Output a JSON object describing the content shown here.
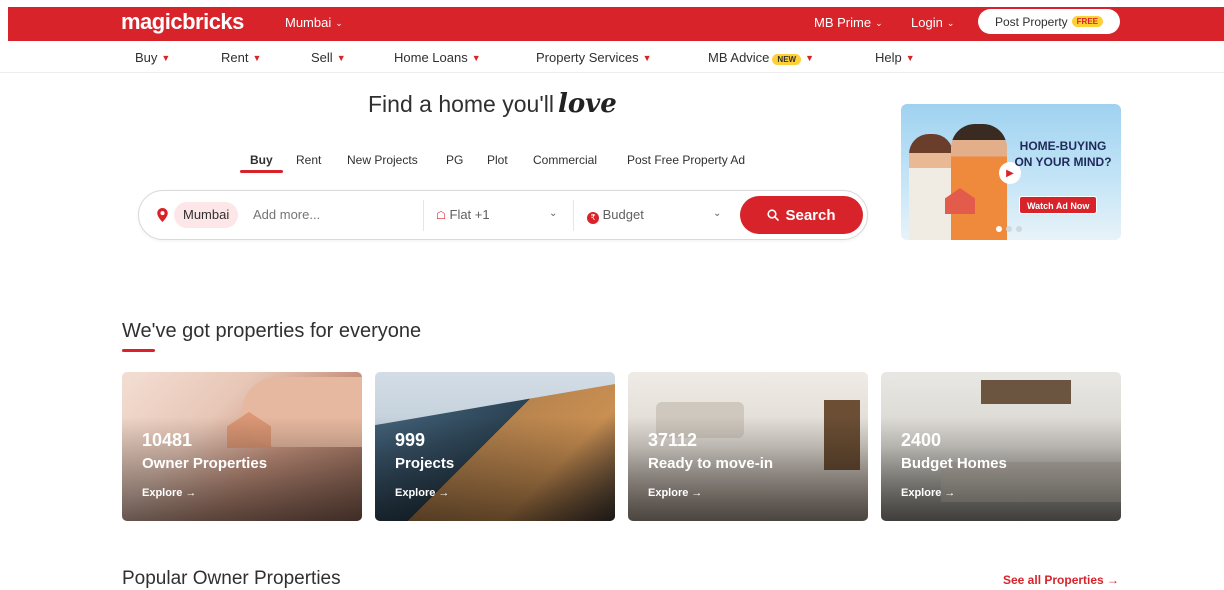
{
  "header": {
    "logo": "magicbricks",
    "city": "Mumbai",
    "mb_prime": "MB Prime",
    "login": "Login",
    "post_property": "Post Property",
    "post_property_badge": "FREE"
  },
  "subnav": {
    "items": [
      {
        "label": "Buy"
      },
      {
        "label": "Rent"
      },
      {
        "label": "Sell"
      },
      {
        "label": "Home Loans"
      },
      {
        "label": "Property Services"
      },
      {
        "label": "MB Advice",
        "badge": "NEW"
      },
      {
        "label": "Help"
      }
    ]
  },
  "hero": {
    "title": "Find a home you'll",
    "title_script": "love"
  },
  "search_tabs": {
    "active": "Buy",
    "items": [
      "Buy",
      "Rent",
      "New Projects",
      "PG",
      "Plot",
      "Commercial",
      "Post Free Property Ad"
    ]
  },
  "search": {
    "city_chip": "Mumbai",
    "placeholder": "Add more...",
    "property_type": "Flat +1",
    "budget": "Budget",
    "button_label": "Search"
  },
  "ad": {
    "headline": "HOME-BUYING ON YOUR MIND?",
    "cta": "Watch Ad Now",
    "slides": 3,
    "active_slide": 1
  },
  "section_everyone": {
    "title": "We've got properties for everyone",
    "cards": [
      {
        "count": "10481",
        "label": "Owner Properties",
        "explore": "Explore →"
      },
      {
        "count": "999",
        "label": "Projects",
        "explore": "Explore →"
      },
      {
        "count": "37112",
        "label": "Ready to move-in",
        "explore": "Explore →"
      },
      {
        "count": "2400",
        "label": "Budget Homes",
        "explore": "Explore →"
      }
    ]
  },
  "section_popular": {
    "title": "Popular Owner Properties",
    "see_all": "See all Properties →"
  },
  "colors": {
    "brand_red": "#d8232a",
    "badge_yellow": "#ffcf36"
  }
}
